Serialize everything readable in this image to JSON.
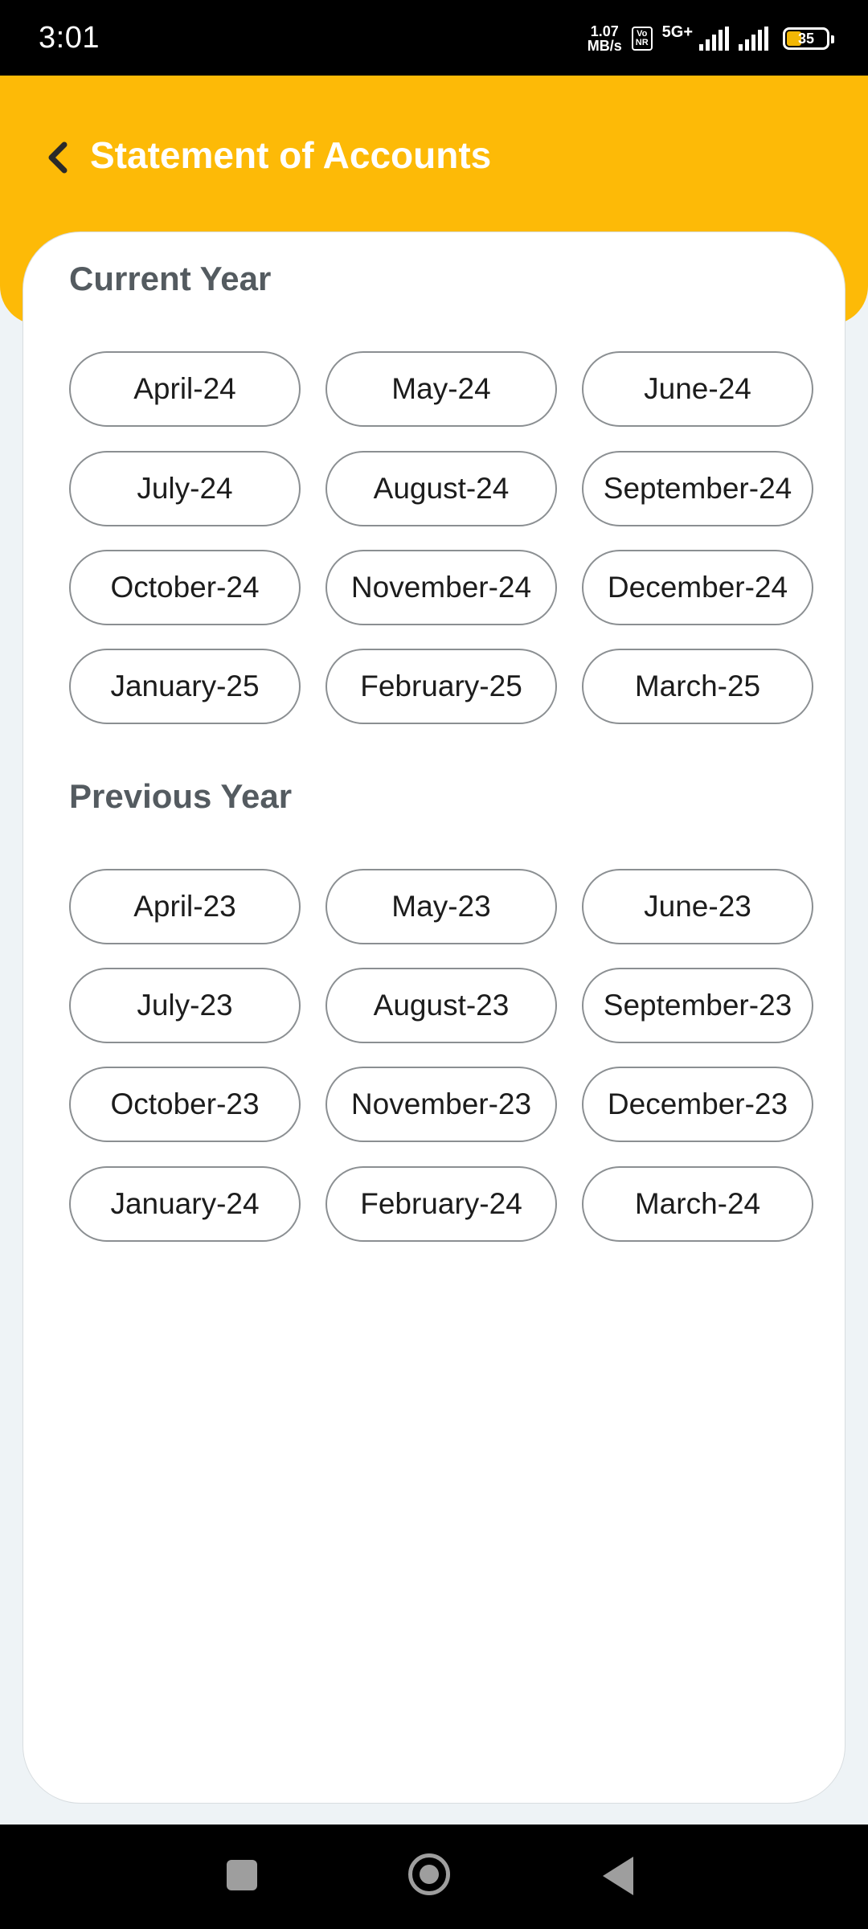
{
  "status_bar": {
    "time": "3:01",
    "net_speed_value": "1.07",
    "net_speed_unit": "MB/s",
    "volte_top": "Vo",
    "volte_bottom": "NR",
    "network": "5G+",
    "battery": "35"
  },
  "header": {
    "title": "Statement of Accounts",
    "accent_color": "#fdba07"
  },
  "current_year": {
    "title": "Current Year",
    "months": [
      "April-24",
      "May-24",
      "June-24",
      "July-24",
      "August-24",
      "September-24",
      "October-24",
      "November-24",
      "December-24",
      "January-25",
      "February-25",
      "March-25"
    ]
  },
  "previous_year": {
    "title": "Previous Year",
    "months": [
      "April-23",
      "May-23",
      "June-23",
      "July-23",
      "August-23",
      "September-23",
      "October-23",
      "November-23",
      "December-23",
      "January-24",
      "February-24",
      "March-24"
    ]
  },
  "nav_bar": {
    "icons": [
      "recents-icon",
      "home-icon",
      "back-icon"
    ]
  }
}
